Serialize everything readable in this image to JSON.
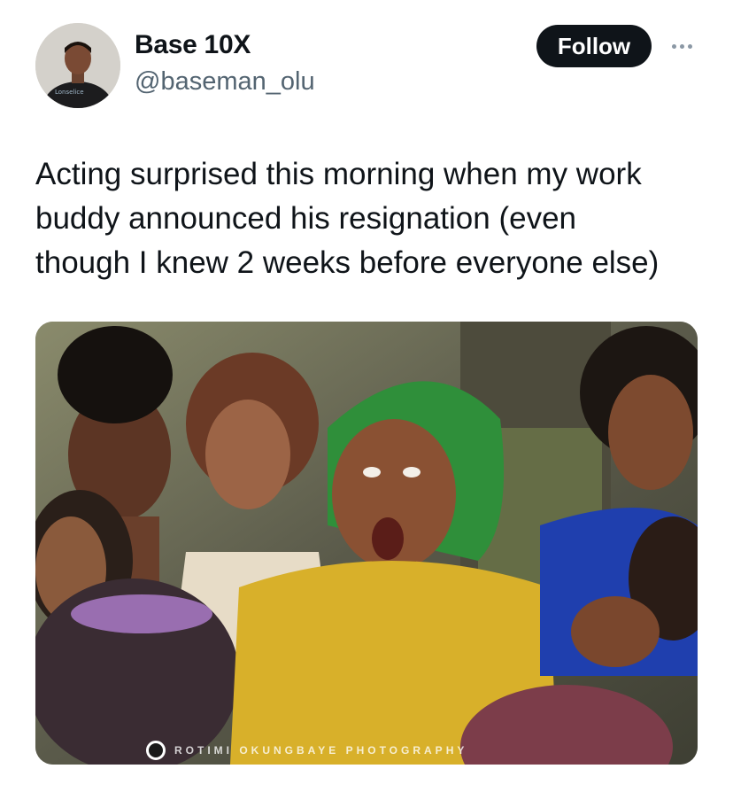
{
  "author": {
    "display_name": "Base 10X",
    "handle": "@baseman_olu",
    "avatar_shirt_text": "Lonselice"
  },
  "actions": {
    "follow_label": "Follow",
    "more_icon": "more-horizontal-icon"
  },
  "tweet": {
    "text": "Acting surprised this morning when my work\nbuddy announced his resignation (even\nthough I knew 2 weeks before everyone else)"
  },
  "media": {
    "watermark": "ROTIMI OKUNGBAYE PHOTOGRAPHY"
  },
  "colors": {
    "text": "#0f1419",
    "secondary_text": "#536471",
    "follow_button_bg": "#0f1419",
    "background": "#ffffff"
  }
}
